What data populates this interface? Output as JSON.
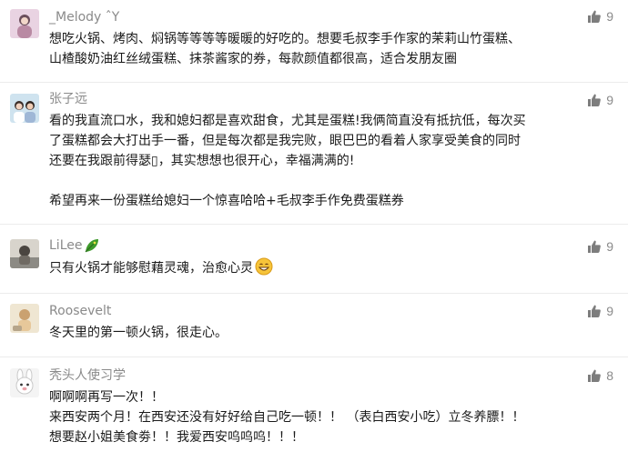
{
  "comments": [
    {
      "nickname": "_Melody ˆY",
      "likes": "9",
      "lines": [
        "想吃火锅、烤肉、焖锅等等等等暖暖的好吃的。想要毛叔李手作家的茉莉山竹蛋糕、",
        "山楂酸奶油红丝绒蛋糕、抹茶酱家的券，每款颜值都很高，适合发朋友圈"
      ]
    },
    {
      "nickname": "张子远",
      "likes": "9",
      "lines": [
        "看的我直流口水，我和媳妇都是喜欢甜食，尤其是蛋糕!我俩简直没有抵抗低，每次买",
        "了蛋糕都会大打出手一番，但是每次都是我完败，眼巴巴的看着人家享受美食的同时",
        "还要在我跟前得瑟▯，其实想想也很开心，幸福满满的!"
      ],
      "lines_after_gap": [
        "希望再来一份蛋糕给媳妇一个惊喜哈哈+毛叔李手作免费蛋糕券"
      ]
    },
    {
      "nickname": "LiLee",
      "likes": "9",
      "lines": [
        "只有火锅才能够慰藉灵魂，治愈心灵"
      ]
    },
    {
      "nickname": "Roosevelt",
      "likes": "9",
      "lines": [
        "冬天里的第一顿火锅，很走心。"
      ]
    },
    {
      "nickname": "秃头人使习学",
      "likes": "8",
      "lines": [
        "啊啊啊再写一次！！",
        "来西安两个月！在西安还没有好好给自己吃一顿！！ （表白西安小吃）立冬养膘！！",
        "想要赵小姐美食劵！！我爱西安呜呜呜！！！"
      ]
    }
  ],
  "icons": {
    "like": "thumbs-up-icon",
    "badge": "leaf-badge-icon",
    "emoji": "grinning-face-emoji"
  },
  "colors": {
    "nickname": "#8a8a8a",
    "text": "#1a1a1a",
    "like_icon": "#7d7d7d",
    "divider": "#ececec"
  }
}
